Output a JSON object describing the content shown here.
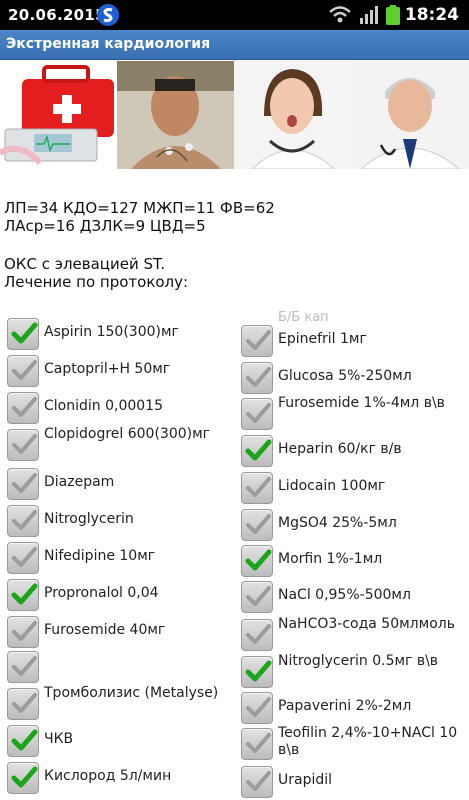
{
  "status": {
    "date": "20.06.2015",
    "time": "18:24"
  },
  "header": {
    "title": "Экстренная кардиология"
  },
  "metrics": {
    "line1": "ЛП=34 КДО=127 МЖП=11 ФВ=62",
    "line2": "ЛАср=16 ДЗЛК=9 ЦВД=5"
  },
  "diagnosis": {
    "line1": "ОКС с элевацией ST.",
    "line2": "Лечение по протоколу:"
  },
  "left_items": [
    {
      "label": "Aspirin 150(300)мг",
      "checked": true
    },
    {
      "label": "Captopril+H 50мг",
      "checked": false
    },
    {
      "label": "Clonidin 0,00015",
      "checked": false
    },
    {
      "label": "Clopidogrel 600(300)мг",
      "checked": false
    },
    {
      "label": "Diazepam",
      "checked": false
    },
    {
      "label": "Nitroglycerin",
      "checked": false
    },
    {
      "label": "Nifedipine 10мг",
      "checked": false
    },
    {
      "label": "Propronalol 0,04",
      "checked": true
    },
    {
      "label": "Furosemide 40мг",
      "checked": false
    },
    {
      "label": "",
      "checked": false
    },
    {
      "label": "Тромболизис (Metalyse)",
      "checked": false
    },
    {
      "label": "ЧКВ",
      "checked": true
    },
    {
      "label": "Кислород 5л/мин",
      "checked": true
    }
  ],
  "right_faded": "Б/Б кап",
  "right_items": [
    {
      "label": "Epinefril 1мг",
      "checked": false
    },
    {
      "label": "Glucosa 5%-250мл",
      "checked": false
    },
    {
      "label": "Furosemide 1%-4мл в\\в",
      "checked": false
    },
    {
      "label": "Heparin 60/кг в/в",
      "checked": true
    },
    {
      "label": "Lidocain 100мг",
      "checked": false
    },
    {
      "label": "MgSO4 25%-5мл",
      "checked": false
    },
    {
      "label": "Morfin 1%-1мл",
      "checked": true
    },
    {
      "label": "NaCl 0,95%-500мл",
      "checked": false
    },
    {
      "label": "NaHCO3-сода 50млмоль",
      "checked": false
    },
    {
      "label": "Nitroglycerin 0.5мг в\\в",
      "checked": true
    },
    {
      "label": "Papaverini 2%-2мл",
      "checked": false
    },
    {
      "label": "Teofilin 2,4%-10+NACl 10 в\\в",
      "checked": false
    },
    {
      "label": "Urapidil",
      "checked": false
    }
  ]
}
